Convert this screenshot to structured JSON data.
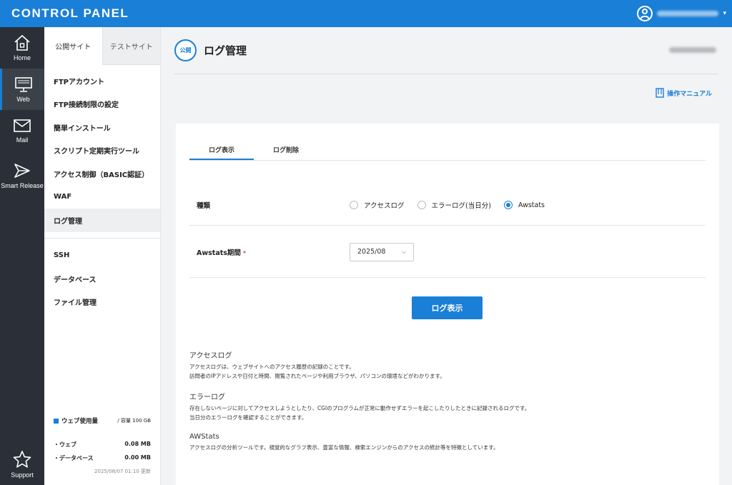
{
  "header": {
    "brand": "CONTROL PANEL"
  },
  "rail": [
    {
      "label": "Home",
      "icon": "home-icon"
    },
    {
      "label": "Web",
      "icon": "monitor-icon",
      "active": true
    },
    {
      "label": "Mail",
      "icon": "mail-icon"
    },
    {
      "label": "Smart Release",
      "icon": "send-icon"
    },
    {
      "label": "Support",
      "icon": "star-icon"
    }
  ],
  "subnav": {
    "tabs": [
      "公開サイト",
      "テストサイト"
    ],
    "items": [
      "FTPアカウント",
      "FTP接続制限の設定",
      "簡単インストール",
      "スクリプト定期実行ツール",
      "アクセス制御（BASIC認証）",
      "WAF",
      "ログ管理",
      "SSH",
      "データベース",
      "ファイル管理"
    ],
    "active_item": "ログ管理",
    "usage": {
      "title": "ウェブ使用量",
      "capacity": "/  容量 100 GB",
      "rows": [
        {
          "label": "・ウェブ",
          "value": "0.08 MB"
        },
        {
          "label": "・データベース",
          "value": "0.00 MB"
        }
      ],
      "updated": "2025/08/07 01:10 更新"
    }
  },
  "page": {
    "badge": "公開",
    "title": "ログ管理",
    "manual_link": "操作マニュアル"
  },
  "tabs": [
    "ログ表示",
    "ログ削除"
  ],
  "form": {
    "type_label": "種類",
    "type_options": [
      "アクセスログ",
      "エラーログ(当日分)",
      "Awstats"
    ],
    "type_selected": "Awstats",
    "period_label": "Awstats期間",
    "required_mark": "*",
    "period_value": "2025/08",
    "submit_label": "ログ表示"
  },
  "descriptions": [
    {
      "title": "アクセスログ",
      "lines": [
        "アクセスログは、ウェブサイトへのアクセス履歴の記録のことです。",
        "訪問者のIPアドレスや日付と時間、閲覧されたページや利用ブラウザ、パソコンの環境などがわかります。"
      ]
    },
    {
      "title": "エラーログ",
      "lines": [
        "存在しないページに対してアクセスしようとしたり、CGIのプログラムが正常に動作せずエラーを起こしたりしたときに記録されるログです。",
        "当日分のエラーログを確認することができます。"
      ]
    },
    {
      "title": "AWStats",
      "lines": [
        "アクセスログの分析ツールです。視覚的なグラフ表示、豊富な情報、検索エンジンからのアクセスの統計等を特徴としています。"
      ]
    }
  ],
  "colors": {
    "accent": "#1a7fd6",
    "rail_bg": "#2b3038"
  }
}
